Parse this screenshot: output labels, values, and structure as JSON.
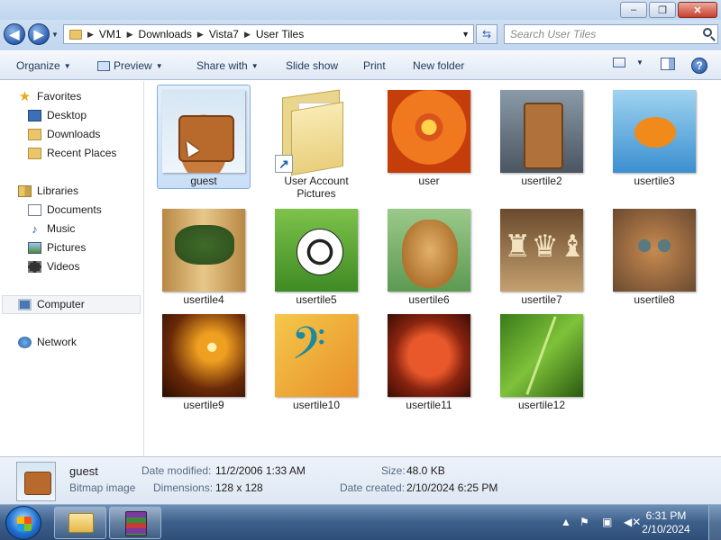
{
  "window": {
    "controls": {
      "minimize_label": "–",
      "maximize_label": "❐",
      "close_label": "✕"
    }
  },
  "address": {
    "back_label": "◀",
    "forward_label": "▶",
    "breadcrumb": [
      "VM1",
      "Downloads",
      "Vista7",
      "User Tiles"
    ],
    "refresh_label": "⇆"
  },
  "search": {
    "placeholder": "Search User Tiles"
  },
  "toolbar": {
    "organize": "Organize",
    "preview": "Preview",
    "share_with": "Share with",
    "slide_show": "Slide show",
    "print": "Print",
    "new_folder": "New folder",
    "help_label": "?"
  },
  "nav": {
    "favorites": "Favorites",
    "favorites_items": [
      "Desktop",
      "Downloads",
      "Recent Places"
    ],
    "libraries": "Libraries",
    "libraries_items": [
      "Documents",
      "Music",
      "Pictures",
      "Videos"
    ],
    "computer": "Computer",
    "network": "Network"
  },
  "files": [
    {
      "name": "guest",
      "selected": true
    },
    {
      "name": "User Account Pictures",
      "shortcut": true
    },
    {
      "name": "user"
    },
    {
      "name": "usertile2"
    },
    {
      "name": "usertile3"
    },
    {
      "name": "usertile4"
    },
    {
      "name": "usertile5"
    },
    {
      "name": "usertile6"
    },
    {
      "name": "usertile7"
    },
    {
      "name": "usertile8"
    },
    {
      "name": "usertile9"
    },
    {
      "name": "usertile10"
    },
    {
      "name": "usertile11"
    },
    {
      "name": "usertile12"
    }
  ],
  "details": {
    "name": "guest",
    "type": "Bitmap image",
    "date_modified_label": "Date modified:",
    "date_modified": "11/2/2006 1:33 AM",
    "dimensions_label": "Dimensions:",
    "dimensions": "128 x 128",
    "size_label": "Size:",
    "size": "48.0 KB",
    "date_created_label": "Date created:",
    "date_created": "2/10/2024 6:25 PM"
  },
  "taskbar": {
    "time": "6:31 PM",
    "date": "2/10/2024",
    "tray_icons": [
      "up-arrow-icon",
      "flag-icon",
      "network-icon",
      "volume-muted-icon"
    ]
  },
  "colors": {
    "selection": "#c9dff7",
    "taskbar": "#3c5f8a",
    "link_text": "#1e395b"
  }
}
